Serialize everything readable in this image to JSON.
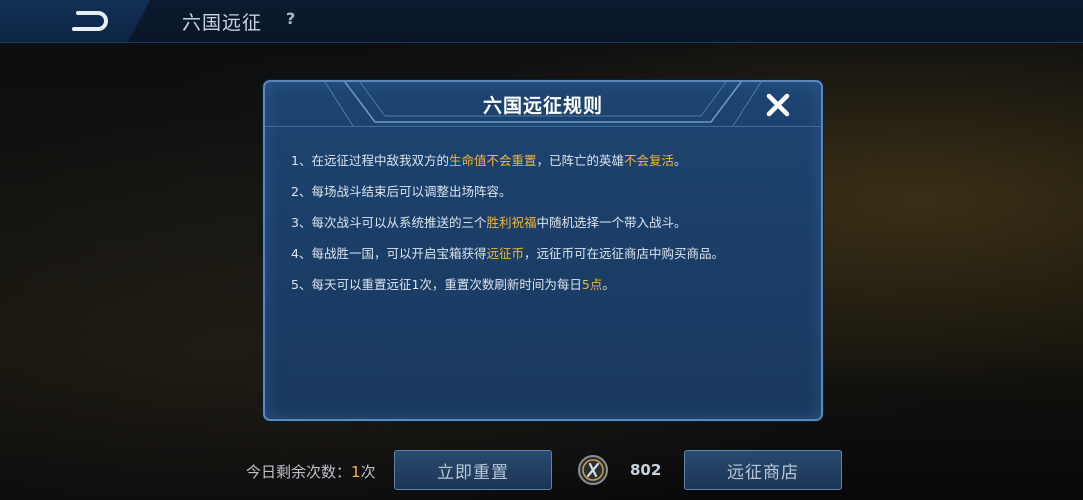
{
  "topbar": {
    "title": "六国远征",
    "help_label": "?"
  },
  "dialog": {
    "title": "六国远征规则",
    "rules": [
      {
        "parts": [
          {
            "text": "1、在远征过程中敌我双方的",
            "highlight": false
          },
          {
            "text": "生命值不会重置",
            "highlight": true
          },
          {
            "text": "，已阵亡的英雄",
            "highlight": false
          },
          {
            "text": "不会复活",
            "highlight": true
          },
          {
            "text": "。",
            "highlight": false
          }
        ]
      },
      {
        "parts": [
          {
            "text": "2、每场战斗结束后可以调整出场阵容。",
            "highlight": false
          }
        ]
      },
      {
        "parts": [
          {
            "text": "3、每次战斗可以从系统推送的三个",
            "highlight": false
          },
          {
            "text": "胜利祝福",
            "highlight": true
          },
          {
            "text": "中随机选择一个带入战斗。",
            "highlight": false
          }
        ]
      },
      {
        "parts": [
          {
            "text": "4、每战胜一国，可以开启宝箱获得",
            "highlight": false
          },
          {
            "text": "远征币",
            "highlight": true
          },
          {
            "text": "，远征币可在远征商店中购买商品。",
            "highlight": false
          }
        ]
      },
      {
        "parts": [
          {
            "text": "5、每天可以重置远征1次，重置次数刷新时间为每日",
            "highlight": false
          },
          {
            "text": "5点",
            "highlight": true
          },
          {
            "text": "。",
            "highlight": false
          }
        ]
      }
    ]
  },
  "bottom": {
    "remain_label": "今日剩余次数：",
    "remain_count": "1",
    "remain_suffix": "次",
    "reset_button": "立即重置",
    "coin_value": "802",
    "shop_button": "远征商店"
  },
  "colors": {
    "highlight": "#f3b53a",
    "dialog_bg": "#1b3f69",
    "dialog_border": "#5c87b8"
  },
  "icons": {
    "back": "back-arrow-icon",
    "close": "close-icon",
    "coin": "expedition-coin-icon"
  }
}
